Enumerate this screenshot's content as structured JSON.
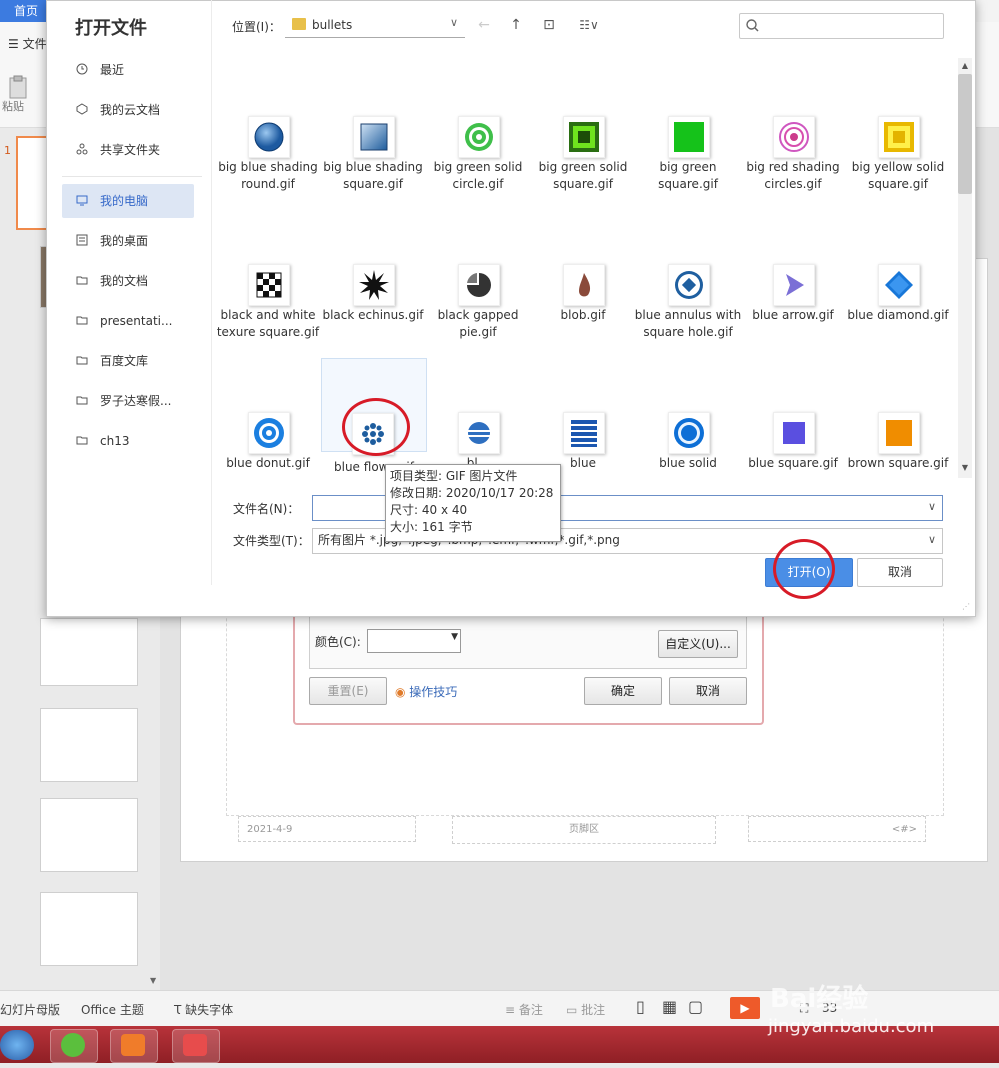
{
  "app": {
    "home_tab": "首页",
    "file_menu": "文件",
    "paste_label": "粘贴",
    "slide_number": "1",
    "footer_date": "2021-4-9",
    "footer_center": "页脚区",
    "footer_page": "<#>"
  },
  "status_bar": {
    "master": "幻灯片母版",
    "theme": "Office 主题",
    "missing_fonts": "缺失字体",
    "notes": "备注",
    "comments": "批注",
    "zoom": "33"
  },
  "bg_dialog": {
    "color_label": "颜色(C):",
    "custom_button": "自定义(U)...",
    "reset_button": "重置(E)",
    "tips_link": "操作技巧",
    "ok_button": "确定",
    "cancel_button": "取消"
  },
  "dialog": {
    "title": "打开文件",
    "nav": [
      {
        "label": "最近",
        "icon": "clock-icon"
      },
      {
        "label": "我的云文档",
        "icon": "cloud-icon"
      },
      {
        "label": "共享文件夹",
        "icon": "share-icon"
      },
      {
        "label": "我的电脑",
        "icon": "computer-icon"
      },
      {
        "label": "我的桌面",
        "icon": "desktop-icon"
      },
      {
        "label": "我的文档",
        "icon": "folder-icon"
      },
      {
        "label": "presentati...",
        "icon": "folder-icon"
      },
      {
        "label": "百度文库",
        "icon": "folder-icon"
      },
      {
        "label": "罗子达寒假...",
        "icon": "folder-icon"
      },
      {
        "label": "ch13",
        "icon": "folder-icon"
      }
    ],
    "location_label": "位置(I)：",
    "location": "bullets",
    "filename_label": "文件名(N)：",
    "filename_value": "",
    "filetype_label": "文件类型(T)：",
    "filetype_value": "所有图片 *.jpg,*.jpeg,*.bmp,*.emf,*.wmf,*.gif,*.png",
    "open_button": "打开(O)",
    "cancel_button": "取消",
    "files": [
      {
        "name": "big blue shading round.gif"
      },
      {
        "name": "big blue shading square.gif"
      },
      {
        "name": "big green solid circle.gif"
      },
      {
        "name": "big green solid square.gif"
      },
      {
        "name": "big green square.gif"
      },
      {
        "name": "big red shading circles.gif"
      },
      {
        "name": "big yellow solid square.gif"
      },
      {
        "name": "black and white texure square.gif"
      },
      {
        "name": "black echinus.gif"
      },
      {
        "name": "black gapped pie.gif"
      },
      {
        "name": "blob.gif"
      },
      {
        "name": "blue annulus with square hole.gif"
      },
      {
        "name": "blue arrow.gif"
      },
      {
        "name": "blue diamond.gif"
      },
      {
        "name": "blue donut.gif"
      },
      {
        "name": "blue flow...gif"
      },
      {
        "name": "bl..."
      },
      {
        "name": "blue"
      },
      {
        "name": "blue solid"
      },
      {
        "name": "blue square.gif"
      },
      {
        "name": "brown square.gif"
      }
    ],
    "tooltip": {
      "type": "项目类型: GIF 图片文件",
      "date": "修改日期: 2020/10/17 20:28",
      "size": "尺寸: 40 x 40",
      "bytes": "大小: 161 字节"
    }
  },
  "watermark": {
    "brand": "Bai经验",
    "url": "jingyan.baidu.com"
  }
}
